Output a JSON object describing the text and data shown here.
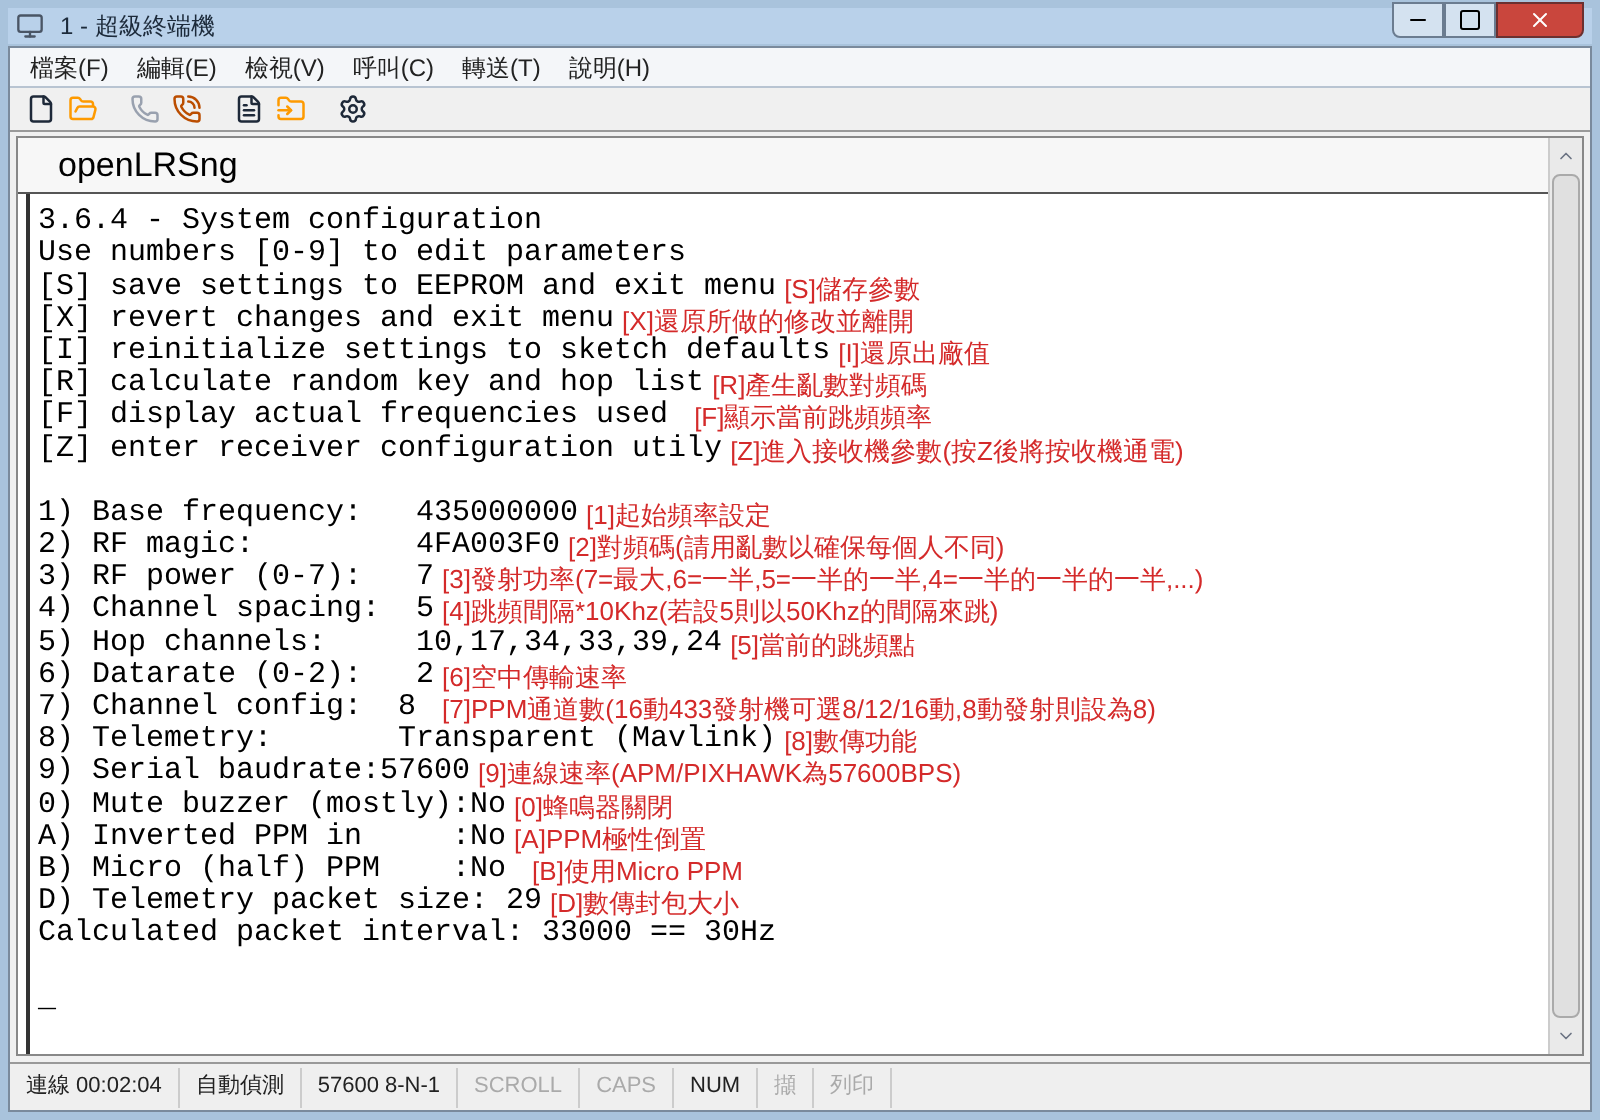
{
  "window": {
    "title": "1 - 超級終端機"
  },
  "menu": [
    "檔案(F)",
    "編輯(E)",
    "檢視(V)",
    "呼叫(C)",
    "轉送(T)",
    "說明(H)"
  ],
  "terminal": {
    "header": "openLRSng",
    "lines": [
      {
        "text": "3.6.4 - System configuration"
      },
      {
        "text": "Use numbers [0-9] to edit parameters"
      },
      {
        "text": "[S] save settings to EEPROM and exit menu",
        "note": "[S]儲存參數"
      },
      {
        "text": "[X] revert changes and exit menu",
        "note": "[X]還原所做的修改並離開"
      },
      {
        "text": "[I] reinitialize settings to sketch defaults",
        "note": "[I]還原出廠值"
      },
      {
        "text": "[R] calculate random key and hop list",
        "note": "[R]產生亂數對頻碼"
      },
      {
        "text": "[F] display actual frequencies used ",
        "note": "[F]顯示當前跳頻頻率"
      },
      {
        "text": "[Z] enter receiver configuration utily",
        "note": "[Z]進入接收機參數(按Z後將按收機通電)"
      },
      {
        "gap_before": true,
        "text": "1) Base frequency:   435000000",
        "note": "[1]起始頻率設定"
      },
      {
        "text": "2) RF magic:         4FA003F0",
        "note": "[2]對頻碼(請用亂數以確保每個人不同)"
      },
      {
        "text": "3) RF power (0-7):   7",
        "note": "[3]發射功率(7=最大,6=一半,5=一半的一半,4=一半的一半的一半,...)"
      },
      {
        "text": "4) Channel spacing:  5",
        "note": "[4]跳頻間隔*10Khz(若設5則以50Khz的間隔來跳)"
      },
      {
        "text": "5) Hop channels:     10,17,34,33,39,24",
        "note": "[5]當前的跳頻點"
      },
      {
        "text": "6) Datarate (0-2):   2",
        "note": "[6]空中傳輸速率"
      },
      {
        "text": "7) Channel config:  8 ",
        "note": "[7]PPM通道數(16動433發射機可選8/12/16動,8動發射則設為8)"
      },
      {
        "text": "8) Telemetry:       Transparent (Mavlink)",
        "note": "[8]數傳功能"
      },
      {
        "text": "9) Serial baudrate:57600",
        "note": "[9]連線速率(APM/PIXHAWK為57600BPS)"
      },
      {
        "text": "0) Mute buzzer (mostly):No",
        "note": "[0]蜂鳴器關閉"
      },
      {
        "text": "A) Inverted PPM in     :No",
        "note": "[A]PPM極性倒置"
      },
      {
        "text": "B) Micro (half) PPM    :No ",
        "note": "[B]使用Micro PPM"
      },
      {
        "text": "D) Telemetry packet size: 29",
        "note": "[D]數傳封包大小"
      },
      {
        "text": "Calculated packet interval: 33000 == 30Hz"
      },
      {
        "gap_before": true,
        "text": "_"
      }
    ]
  },
  "status_bar": [
    {
      "text": "連線 00:02:04",
      "active": true
    },
    {
      "text": "自動偵測",
      "active": true
    },
    {
      "text": "57600 8-N-1",
      "active": true
    },
    {
      "text": "SCROLL",
      "active": false
    },
    {
      "text": "CAPS",
      "active": false
    },
    {
      "text": "NUM",
      "active": true
    },
    {
      "text": "擷",
      "active": false
    },
    {
      "text": "列印",
      "active": false
    }
  ]
}
